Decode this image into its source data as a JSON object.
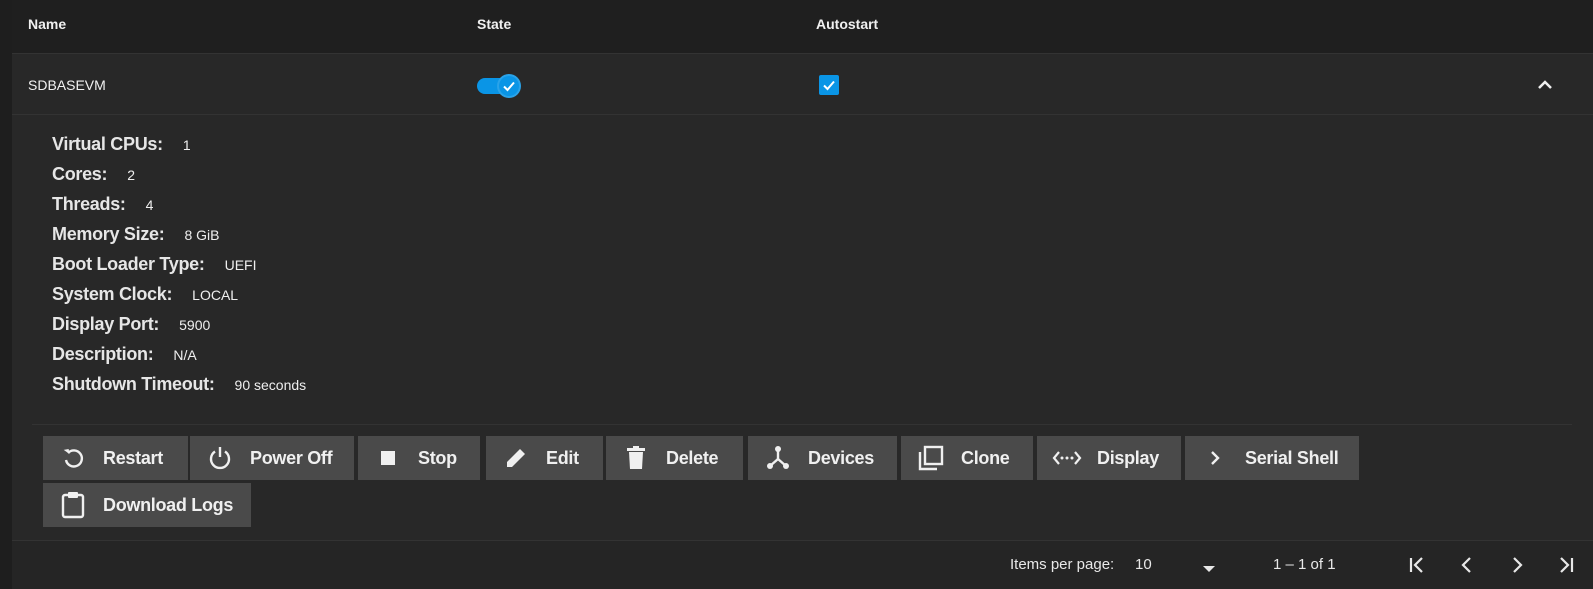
{
  "table": {
    "headers": {
      "name": "Name",
      "state": "State",
      "autostart": "Autostart"
    },
    "row": {
      "name": "SDBASEVM",
      "state_on": true,
      "autostart_checked": true
    }
  },
  "details": [
    {
      "label": "Virtual CPUs:",
      "value": "1"
    },
    {
      "label": "Cores:",
      "value": "2"
    },
    {
      "label": "Threads:",
      "value": "4"
    },
    {
      "label": "Memory Size:",
      "value": "8 GiB"
    },
    {
      "label": "Boot Loader Type:",
      "value": "UEFI"
    },
    {
      "label": "System Clock:",
      "value": "LOCAL"
    },
    {
      "label": "Display Port:",
      "value": "5900"
    },
    {
      "label": "Description:",
      "value": "N/A"
    },
    {
      "label": "Shutdown Timeout:",
      "value": "90 seconds"
    }
  ],
  "actions": [
    {
      "label": "Restart",
      "icon": "restart-icon"
    },
    {
      "label": "Power Off",
      "icon": "power-icon"
    },
    {
      "label": "Stop",
      "icon": "stop-icon"
    },
    {
      "label": "Edit",
      "icon": "pencil-icon"
    },
    {
      "label": "Delete",
      "icon": "trash-icon"
    },
    {
      "label": "Devices",
      "icon": "devices-icon"
    },
    {
      "label": "Clone",
      "icon": "clone-icon"
    },
    {
      "label": "Display",
      "icon": "display-icon"
    },
    {
      "label": "Serial Shell",
      "icon": "chevron-right-icon"
    },
    {
      "label": "Download Logs",
      "icon": "clipboard-icon"
    }
  ],
  "paginator": {
    "items_per_page_label": "Items per page:",
    "items_per_page_value": "10",
    "range_label": "1 – 1 of 1"
  },
  "colors": {
    "accent": "#0a95e6",
    "background": "#282828",
    "header": "#1f1f1f",
    "button": "#4a4a4a"
  }
}
